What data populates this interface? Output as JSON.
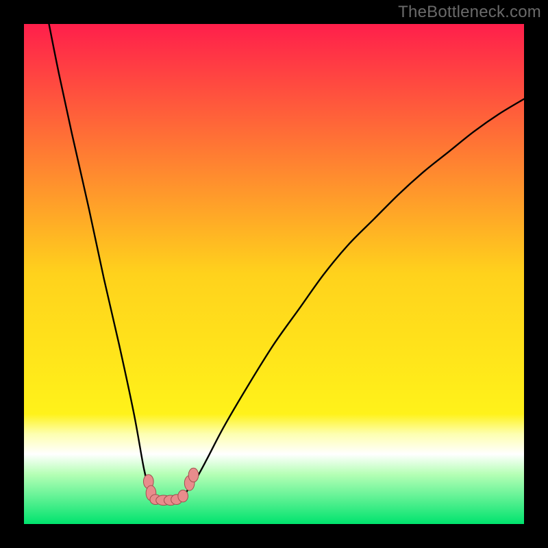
{
  "watermark": "TheBottleneck.com",
  "chart_data": {
    "type": "line",
    "title": "",
    "xlabel": "",
    "ylabel": "",
    "xlim": [
      0,
      100
    ],
    "ylim": [
      0,
      100
    ],
    "grid": false,
    "legend": false,
    "background_gradient": [
      {
        "offset": 0.0,
        "color": "#ff1f4b"
      },
      {
        "offset": 0.5,
        "color": "#ffd21c"
      },
      {
        "offset": 0.78,
        "color": "#fff21a"
      },
      {
        "offset": 0.82,
        "color": "#fdffb0"
      },
      {
        "offset": 0.86,
        "color": "#ffffff"
      },
      {
        "offset": 0.9,
        "color": "#b6ffb6"
      },
      {
        "offset": 1.0,
        "color": "#00e36e"
      }
    ],
    "series": [
      {
        "name": "curve",
        "color": "#000000",
        "x": [
          5.0,
          7.0,
          9.6,
          13.0,
          16.0,
          19.0,
          22.0,
          24.0,
          25.3,
          25.7,
          26.0,
          26.5,
          27.0,
          28.0,
          29.0,
          30.0,
          31.0,
          31.5,
          32.2,
          33.0,
          34.4,
          36.6,
          40.0,
          45.0,
          50.0,
          55.0,
          60.0,
          65.0,
          70.0,
          75.0,
          80.0,
          85.0,
          90.0,
          95.0,
          100.0
        ],
        "y": [
          100.0,
          90.0,
          78.0,
          63.0,
          49.0,
          36.0,
          22.0,
          11.0,
          6.0,
          5.4,
          5.1,
          4.9,
          4.8,
          4.8,
          4.8,
          4.9,
          5.2,
          5.5,
          6.0,
          7.2,
          9.0,
          13.0,
          19.5,
          28.0,
          36.0,
          43.0,
          50.0,
          56.0,
          61.0,
          66.0,
          70.5,
          74.5,
          78.5,
          82.0,
          85.0
        ]
      }
    ],
    "markers": {
      "color": "#e88c8c",
      "stroke": "#a14f4f",
      "points": [
        {
          "x": 24.9,
          "y": 8.5,
          "rx": 1.0,
          "ry": 1.4
        },
        {
          "x": 25.4,
          "y": 6.2,
          "rx": 1.0,
          "ry": 1.5
        },
        {
          "x": 26.3,
          "y": 4.9,
          "rx": 1.1,
          "ry": 1.0
        },
        {
          "x": 27.9,
          "y": 4.75,
          "rx": 1.5,
          "ry": 1.0
        },
        {
          "x": 29.3,
          "y": 4.75,
          "rx": 1.3,
          "ry": 1.0
        },
        {
          "x": 30.5,
          "y": 4.9,
          "rx": 1.1,
          "ry": 1.0
        },
        {
          "x": 31.8,
          "y": 5.6,
          "rx": 1.0,
          "ry": 1.2
        },
        {
          "x": 33.1,
          "y": 8.2,
          "rx": 1.0,
          "ry": 1.5
        },
        {
          "x": 33.9,
          "y": 9.8,
          "rx": 1.0,
          "ry": 1.4
        }
      ]
    }
  }
}
